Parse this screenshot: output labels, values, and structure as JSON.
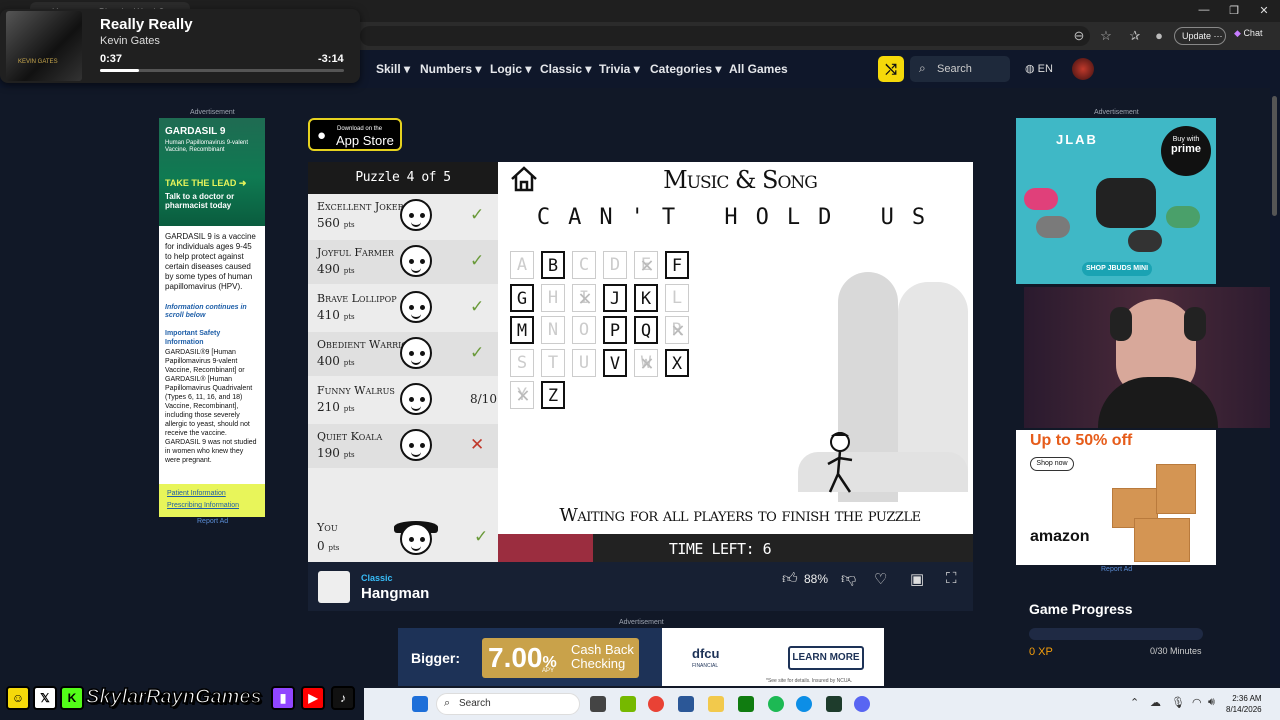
{
  "browser": {
    "tab_title": "Hangman - Play the Word G...",
    "update_label": "Update",
    "chat_label": "Chat"
  },
  "media": {
    "song": "Really Really",
    "artist": "Kevin Gates",
    "time_current": "0:37",
    "time_remaining": "-3:14",
    "progress": 0.16
  },
  "nav": {
    "items": [
      "Skill",
      "Numbers",
      "Logic",
      "Classic",
      "Trivia",
      "Categories",
      "All Games"
    ],
    "search_label": "Search",
    "language": "EN"
  },
  "ads": {
    "advertisement_label": "Advertisement",
    "report_label": "Report Ad",
    "left": {
      "brand": "GARDASIL 9",
      "subtitle": "Human Papillomavirus 9-valent Vaccine, Recombinant",
      "cta": "TAKE THE LEAD",
      "talk": "Talk to a doctor or pharmacist today",
      "body": "GARDASIL 9 is a vaccine for individuals ages 9-45 to help protect against certain diseases caused by some types of human papillomavirus (HPV).",
      "info": "Information continues in scroll below",
      "safety_title": "Important Safety Information",
      "fine": "GARDASIL®9 [Human Papillomavirus 9-valent Vaccine, Recombinant] or GARDASIL® [Human Papillomavirus Quadrivalent (Types 6, 11, 16, and 18) Vaccine, Recombinant], including those severely allergic to yeast, should not receive the vaccine. GARDASIL 9 was not studied in women who knew they were pregnant.",
      "link1": "Patient Information",
      "link2": "Prescribing Information"
    },
    "right_top": {
      "brand": "JLAB",
      "prime_top": "Buy with",
      "prime": "prime",
      "shop": "SHOP JBUDS MINI"
    },
    "right_bottom": {
      "headline": "Up to 50% off",
      "shop": "Shop now",
      "brand": "amazon"
    },
    "bottom": {
      "bigger": "Bigger:",
      "rate": "7.00",
      "pct": "%",
      "apy": "APY",
      "cashback": "Cash Back Checking",
      "brand": "dfcu",
      "brand_sub": "FINANCIAL",
      "learn": "LEARN MORE",
      "fine": "*See site for details. Insured by NCUA."
    }
  },
  "app_store": {
    "small": "Download on the",
    "big": "App Store"
  },
  "game": {
    "puzzle_header": "Puzzle 4 of 5",
    "pts_suffix": "pts",
    "players": [
      {
        "name": "Excellent Joker",
        "points": "560",
        "status": "check"
      },
      {
        "name": "Joyful Farmer",
        "points": "490",
        "status": "check"
      },
      {
        "name": "Brave Lollipop",
        "points": "410",
        "status": "check"
      },
      {
        "name": "Obedient Warrior",
        "points": "400",
        "status": "check"
      },
      {
        "name": "Funny Walrus",
        "points": "210",
        "status": "8/10"
      },
      {
        "name": "Quiet Koala",
        "points": "190",
        "status": "cross"
      }
    ],
    "you": {
      "name": "You",
      "points": "0",
      "status": "check"
    },
    "category": "Music & Song",
    "phrase": "CAN'T HOLD US",
    "letters": [
      {
        "l": "A",
        "s": "guessed"
      },
      {
        "l": "B",
        "s": "available"
      },
      {
        "l": "C",
        "s": "guessed"
      },
      {
        "l": "D",
        "s": "guessed"
      },
      {
        "l": "E",
        "s": "wrong"
      },
      {
        "l": "F",
        "s": "available"
      },
      {
        "l": "G",
        "s": "available"
      },
      {
        "l": "H",
        "s": "guessed"
      },
      {
        "l": "I",
        "s": "wrong"
      },
      {
        "l": "J",
        "s": "available"
      },
      {
        "l": "K",
        "s": "available"
      },
      {
        "l": "L",
        "s": "guessed"
      },
      {
        "l": "M",
        "s": "available"
      },
      {
        "l": "N",
        "s": "guessed"
      },
      {
        "l": "O",
        "s": "guessed"
      },
      {
        "l": "P",
        "s": "available"
      },
      {
        "l": "Q",
        "s": "available"
      },
      {
        "l": "R",
        "s": "wrong"
      },
      {
        "l": "S",
        "s": "guessed"
      },
      {
        "l": "T",
        "s": "guessed"
      },
      {
        "l": "U",
        "s": "guessed"
      },
      {
        "l": "V",
        "s": "available"
      },
      {
        "l": "W",
        "s": "wrong"
      },
      {
        "l": "X",
        "s": "available"
      },
      {
        "l": "Y",
        "s": "wrong"
      },
      {
        "l": "Z",
        "s": "available"
      }
    ],
    "waiting": "Waiting for all players to finish the puzzle",
    "time_left": "TIME LEFT: 6",
    "time_fraction": 0.2
  },
  "game_bar": {
    "category": "Classic",
    "title": "Hangman",
    "like_pct": "88%"
  },
  "progress": {
    "title": "Game Progress",
    "xp": "0 XP",
    "minutes": "0/30 Minutes"
  },
  "stream": {
    "channel": "SkylarRaynGames"
  },
  "taskbar": {
    "search_label": "Search",
    "time": "2:36 AM",
    "date": "8/14/2026"
  },
  "colors": {
    "accent_yellow": "#f5d90a",
    "check_green": "#6a9a3a",
    "cross_red": "#c0392b",
    "timer_fill": "#9b2d3f"
  }
}
